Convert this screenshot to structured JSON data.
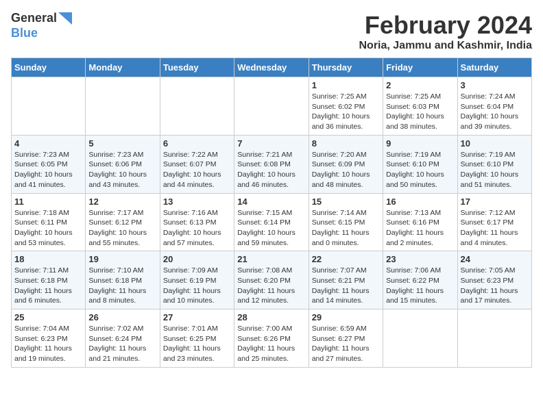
{
  "header": {
    "logo_line1": "General",
    "logo_line2": "Blue",
    "month": "February 2024",
    "location": "Noria, Jammu and Kashmir, India"
  },
  "weekdays": [
    "Sunday",
    "Monday",
    "Tuesday",
    "Wednesday",
    "Thursday",
    "Friday",
    "Saturday"
  ],
  "weeks": [
    [
      {
        "day": "",
        "info": ""
      },
      {
        "day": "",
        "info": ""
      },
      {
        "day": "",
        "info": ""
      },
      {
        "day": "",
        "info": ""
      },
      {
        "day": "1",
        "info": "Sunrise: 7:25 AM\nSunset: 6:02 PM\nDaylight: 10 hours and 36 minutes."
      },
      {
        "day": "2",
        "info": "Sunrise: 7:25 AM\nSunset: 6:03 PM\nDaylight: 10 hours and 38 minutes."
      },
      {
        "day": "3",
        "info": "Sunrise: 7:24 AM\nSunset: 6:04 PM\nDaylight: 10 hours and 39 minutes."
      }
    ],
    [
      {
        "day": "4",
        "info": "Sunrise: 7:23 AM\nSunset: 6:05 PM\nDaylight: 10 hours and 41 minutes."
      },
      {
        "day": "5",
        "info": "Sunrise: 7:23 AM\nSunset: 6:06 PM\nDaylight: 10 hours and 43 minutes."
      },
      {
        "day": "6",
        "info": "Sunrise: 7:22 AM\nSunset: 6:07 PM\nDaylight: 10 hours and 44 minutes."
      },
      {
        "day": "7",
        "info": "Sunrise: 7:21 AM\nSunset: 6:08 PM\nDaylight: 10 hours and 46 minutes."
      },
      {
        "day": "8",
        "info": "Sunrise: 7:20 AM\nSunset: 6:09 PM\nDaylight: 10 hours and 48 minutes."
      },
      {
        "day": "9",
        "info": "Sunrise: 7:19 AM\nSunset: 6:10 PM\nDaylight: 10 hours and 50 minutes."
      },
      {
        "day": "10",
        "info": "Sunrise: 7:19 AM\nSunset: 6:10 PM\nDaylight: 10 hours and 51 minutes."
      }
    ],
    [
      {
        "day": "11",
        "info": "Sunrise: 7:18 AM\nSunset: 6:11 PM\nDaylight: 10 hours and 53 minutes."
      },
      {
        "day": "12",
        "info": "Sunrise: 7:17 AM\nSunset: 6:12 PM\nDaylight: 10 hours and 55 minutes."
      },
      {
        "day": "13",
        "info": "Sunrise: 7:16 AM\nSunset: 6:13 PM\nDaylight: 10 hours and 57 minutes."
      },
      {
        "day": "14",
        "info": "Sunrise: 7:15 AM\nSunset: 6:14 PM\nDaylight: 10 hours and 59 minutes."
      },
      {
        "day": "15",
        "info": "Sunrise: 7:14 AM\nSunset: 6:15 PM\nDaylight: 11 hours and 0 minutes."
      },
      {
        "day": "16",
        "info": "Sunrise: 7:13 AM\nSunset: 6:16 PM\nDaylight: 11 hours and 2 minutes."
      },
      {
        "day": "17",
        "info": "Sunrise: 7:12 AM\nSunset: 6:17 PM\nDaylight: 11 hours and 4 minutes."
      }
    ],
    [
      {
        "day": "18",
        "info": "Sunrise: 7:11 AM\nSunset: 6:18 PM\nDaylight: 11 hours and 6 minutes."
      },
      {
        "day": "19",
        "info": "Sunrise: 7:10 AM\nSunset: 6:18 PM\nDaylight: 11 hours and 8 minutes."
      },
      {
        "day": "20",
        "info": "Sunrise: 7:09 AM\nSunset: 6:19 PM\nDaylight: 11 hours and 10 minutes."
      },
      {
        "day": "21",
        "info": "Sunrise: 7:08 AM\nSunset: 6:20 PM\nDaylight: 11 hours and 12 minutes."
      },
      {
        "day": "22",
        "info": "Sunrise: 7:07 AM\nSunset: 6:21 PM\nDaylight: 11 hours and 14 minutes."
      },
      {
        "day": "23",
        "info": "Sunrise: 7:06 AM\nSunset: 6:22 PM\nDaylight: 11 hours and 15 minutes."
      },
      {
        "day": "24",
        "info": "Sunrise: 7:05 AM\nSunset: 6:23 PM\nDaylight: 11 hours and 17 minutes."
      }
    ],
    [
      {
        "day": "25",
        "info": "Sunrise: 7:04 AM\nSunset: 6:23 PM\nDaylight: 11 hours and 19 minutes."
      },
      {
        "day": "26",
        "info": "Sunrise: 7:02 AM\nSunset: 6:24 PM\nDaylight: 11 hours and 21 minutes."
      },
      {
        "day": "27",
        "info": "Sunrise: 7:01 AM\nSunset: 6:25 PM\nDaylight: 11 hours and 23 minutes."
      },
      {
        "day": "28",
        "info": "Sunrise: 7:00 AM\nSunset: 6:26 PM\nDaylight: 11 hours and 25 minutes."
      },
      {
        "day": "29",
        "info": "Sunrise: 6:59 AM\nSunset: 6:27 PM\nDaylight: 11 hours and 27 minutes."
      },
      {
        "day": "",
        "info": ""
      },
      {
        "day": "",
        "info": ""
      }
    ]
  ]
}
